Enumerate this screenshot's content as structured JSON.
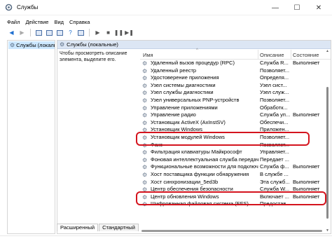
{
  "window": {
    "title": "Службы",
    "minimize_icon": "—",
    "maximize_icon": "☐",
    "close_icon": "✕"
  },
  "menu": {
    "items": [
      "Файл",
      "Действие",
      "Вид",
      "Справка"
    ]
  },
  "tree": {
    "selected_label": "Службы (локальные"
  },
  "pane": {
    "header": "Службы (локальные)",
    "description": "Чтобы просмотреть описание элемента, выделите его."
  },
  "table": {
    "columns": {
      "name": "Имя",
      "description": "Описание",
      "state": "Состояние"
    },
    "rows": [
      {
        "name": "Удаленный вызов процедур (RPC)",
        "description": "Служба R...",
        "state": "Выполняет"
      },
      {
        "name": "Удаленный реестр",
        "description": "Позволяет...",
        "state": ""
      },
      {
        "name": "Удостоверение приложения",
        "description": "Определя...",
        "state": ""
      },
      {
        "name": "Узел системы диагностики",
        "description": "Узел сист...",
        "state": ""
      },
      {
        "name": "Узел службы диагностики",
        "description": "Узел служ...",
        "state": ""
      },
      {
        "name": "Узел универсальных PNP-устройств",
        "description": "Позволяет...",
        "state": ""
      },
      {
        "name": "Управление приложениями",
        "description": "Обработк...",
        "state": ""
      },
      {
        "name": "Управление радио",
        "description": "Служба уп...",
        "state": "Выполняет"
      },
      {
        "name": "Установщик ActiveX (AxInstSV)",
        "description": "Обеспечи...",
        "state": ""
      },
      {
        "name": "Установщик Windows",
        "description": "Приложен...",
        "state": ""
      },
      {
        "name": "Установщик модулей Windows",
        "description": "Позволяет...",
        "state": ""
      },
      {
        "name": "Факс",
        "description": "Позволяет...",
        "state": ""
      },
      {
        "name": "Фильтрация клавиатуры Майкрософт",
        "description": "Управляет...",
        "state": ""
      },
      {
        "name": "Фоновая интеллектуальная служба передачи (BITS)",
        "description": "Передает ...",
        "state": ""
      },
      {
        "name": "Функциональные возможности для подключенных пол...",
        "description": "Служба ф...",
        "state": "Выполняет"
      },
      {
        "name": "Хост поставщика функции обнаружения",
        "description": "В службе ...",
        "state": ""
      },
      {
        "name": "Хост синхронизации_5ed3b",
        "description": "Эта служб...",
        "state": "Выполняет"
      },
      {
        "name": "Центр обеспечения безопасности",
        "description": "Служба W...",
        "state": "Выполняет"
      },
      {
        "name": "Центр обновления Windows",
        "description": "Включает ...",
        "state": "Выполняет"
      },
      {
        "name": "Шифрованная файловая система (EFS)",
        "description": "Предостав...",
        "state": ""
      }
    ]
  },
  "tabs": [
    "Расширенный",
    "Стандартный"
  ],
  "highlight_color": "#d4141e",
  "icons": {
    "window": "services-app-icon",
    "service": "gear-icon",
    "back": "back-arrow-icon",
    "forward": "forward-arrow-icon",
    "play": "play-icon",
    "stop": "stop-icon",
    "pause": "pause-icon",
    "restart": "restart-icon"
  }
}
